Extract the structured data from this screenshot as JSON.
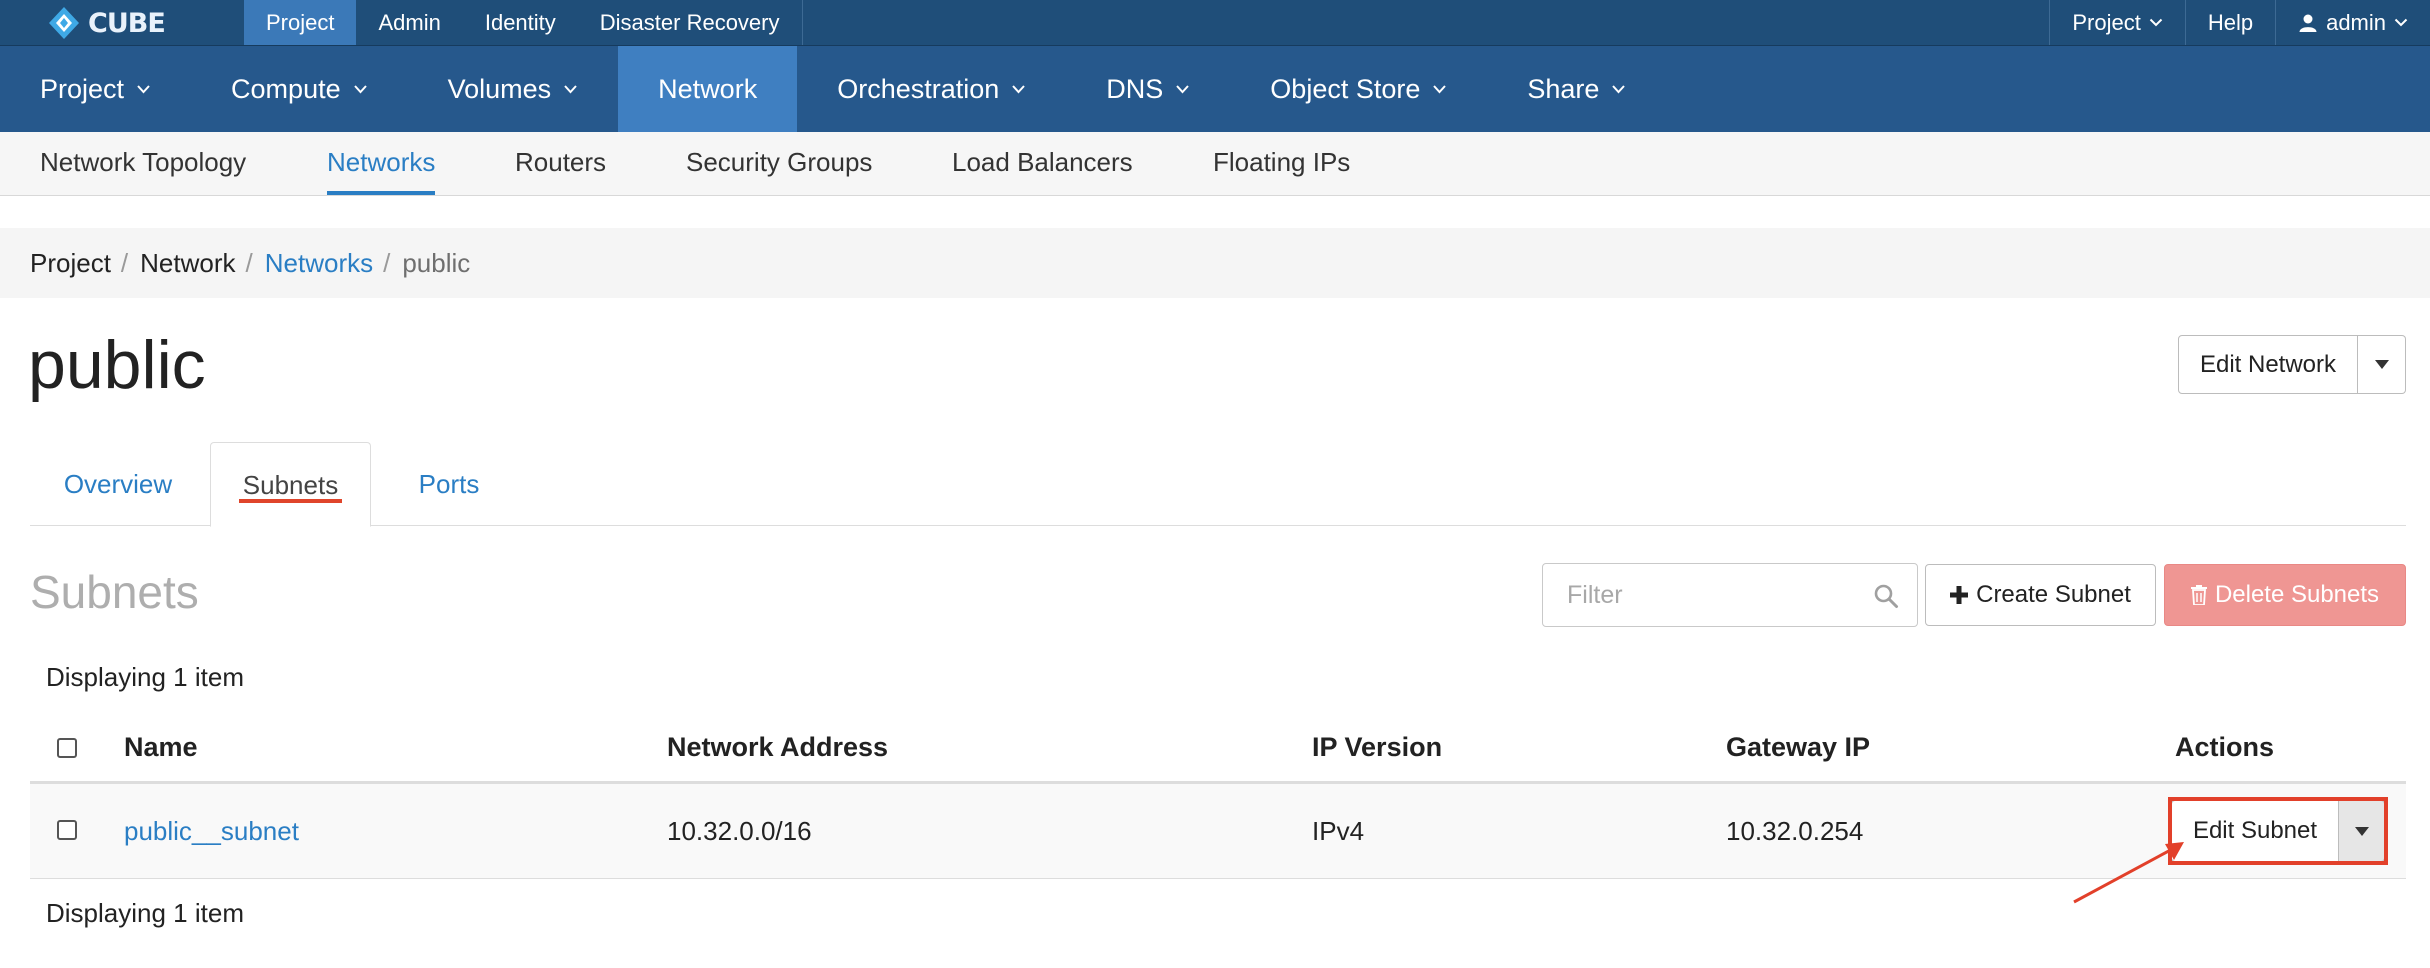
{
  "brand": {
    "name": "CUBE"
  },
  "top_tabs": [
    {
      "label": "Project",
      "active": true
    },
    {
      "label": "Admin",
      "active": false
    },
    {
      "label": "Identity",
      "active": false
    },
    {
      "label": "Disaster Recovery",
      "active": false
    }
  ],
  "top_right": {
    "project_label": "Project",
    "help_label": "Help",
    "user_label": "admin"
  },
  "main_nav": [
    {
      "label": "Project",
      "active": false
    },
    {
      "label": "Compute",
      "active": false
    },
    {
      "label": "Volumes",
      "active": false
    },
    {
      "label": "Network",
      "active": true
    },
    {
      "label": "Orchestration",
      "active": false
    },
    {
      "label": "DNS",
      "active": false
    },
    {
      "label": "Object Store",
      "active": false
    },
    {
      "label": "Share",
      "active": false
    }
  ],
  "sub_nav": [
    {
      "label": "Network Topology",
      "active": false
    },
    {
      "label": "Networks",
      "active": true
    },
    {
      "label": "Routers",
      "active": false
    },
    {
      "label": "Security Groups",
      "active": false
    },
    {
      "label": "Load Balancers",
      "active": false
    },
    {
      "label": "Floating IPs",
      "active": false
    }
  ],
  "breadcrumb": [
    "Project",
    "Network",
    "Networks",
    "public"
  ],
  "page": {
    "title": "public",
    "edit_network_label": "Edit Network"
  },
  "content_tabs": [
    {
      "label": "Overview",
      "active": false
    },
    {
      "label": "Subnets",
      "active": true
    },
    {
      "label": "Ports",
      "active": false
    }
  ],
  "subnets": {
    "title": "Subnets",
    "filter_placeholder": "Filter",
    "create_label": "Create Subnet",
    "delete_label": "Delete Subnets",
    "display_count": "Displaying 1 item",
    "columns": [
      "Name",
      "Network Address",
      "IP Version",
      "Gateway IP",
      "Actions"
    ],
    "rows": [
      {
        "name": "public__subnet",
        "network_address": "10.32.0.0/16",
        "ip_version": "IPv4",
        "gateway_ip": "10.32.0.254",
        "action_label": "Edit Subnet"
      }
    ]
  },
  "colors": {
    "topbar": "#1f4e79",
    "mainnav": "#26588c",
    "mainnav_active": "#3f7fc1",
    "link": "#2a7ec4",
    "danger_button": "#ef9693",
    "annotation": "#e2402a"
  },
  "icons": [
    "cube-logo-icon",
    "chevron-down-icon",
    "user-icon",
    "search-icon",
    "plus-icon",
    "trash-icon",
    "caret-down-icon",
    "annotation-arrow-icon"
  ]
}
